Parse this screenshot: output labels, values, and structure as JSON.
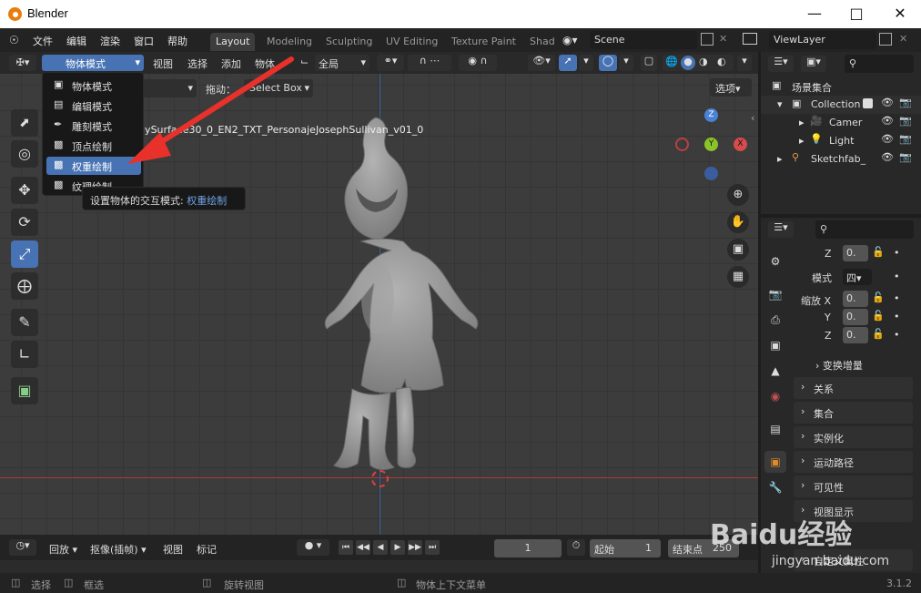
{
  "app": {
    "title": "Blender",
    "version": "3.1.2"
  },
  "menu": [
    "文件",
    "编辑",
    "渲染",
    "窗口",
    "帮助"
  ],
  "workspaces": [
    "Layout",
    "Modeling",
    "Sculpting",
    "UV Editing",
    "Texture Paint",
    "Shad"
  ],
  "scene": "Scene",
  "view_layer": "ViewLayer",
  "viewport_header": {
    "mode": "物体模式",
    "view": "视图",
    "select": "选择",
    "add": "添加",
    "object": "物体",
    "orientation": "全局"
  },
  "tool_header": {
    "default_label": "认",
    "drag_label": "拖动：",
    "drag_value": "Select Box",
    "options": "选项"
  },
  "object_name": "lySurface30_0_EN2_TXT_PersonajeJosephSullivan_v01_0",
  "mode_dropdown": {
    "items": [
      "物体模式",
      "编辑模式",
      "雕刻模式",
      "顶点绘制",
      "权重绘制",
      "纹理绘制"
    ],
    "highlighted": "权重绘制"
  },
  "tooltip": {
    "prefix": "设置物体的交互模式: ",
    "value": "权重绘制"
  },
  "gizmo": {
    "z": "Z",
    "y": "Y",
    "x": "X"
  },
  "outliner": {
    "root": "场景集合",
    "items": [
      {
        "label": "Collection"
      },
      {
        "label": "Camer"
      },
      {
        "label": "Light"
      },
      {
        "label": "Sketchfab_"
      }
    ]
  },
  "properties": {
    "z_label": "Z",
    "z_value": "0.",
    "mode_label": "模式",
    "mode_value": "四",
    "scale_x_label": "缩放 X",
    "scale_x": "0.",
    "scale_y_label": "Y",
    "scale_y": "0.",
    "scale_z_label": "Z",
    "scale_z": "0.",
    "delta": "变换增量",
    "sections": [
      "关系",
      "集合",
      "实例化",
      "运动路径",
      "可见性",
      "视图显示",
      "自定义属性"
    ]
  },
  "timeline": {
    "playback": "回放",
    "keying": "抠像(插帧)",
    "view": "视图",
    "marker": "标记",
    "current_frame": "1",
    "start_label": "起始",
    "start": "1",
    "end_label": "结束点",
    "end": "250"
  },
  "status": {
    "select": "选择",
    "box": "框选",
    "rotate": "旋转视图",
    "context": "物体上下文菜单"
  },
  "watermark": {
    "text": "Baidu经验",
    "url": "jingyan.baidu.com"
  },
  "colors": {
    "accent": "#4772b3",
    "arrow": "#e8312b",
    "x_axis": "#d64b4b",
    "y_axis": "#8bc42a",
    "z_axis": "#4a82d6"
  }
}
